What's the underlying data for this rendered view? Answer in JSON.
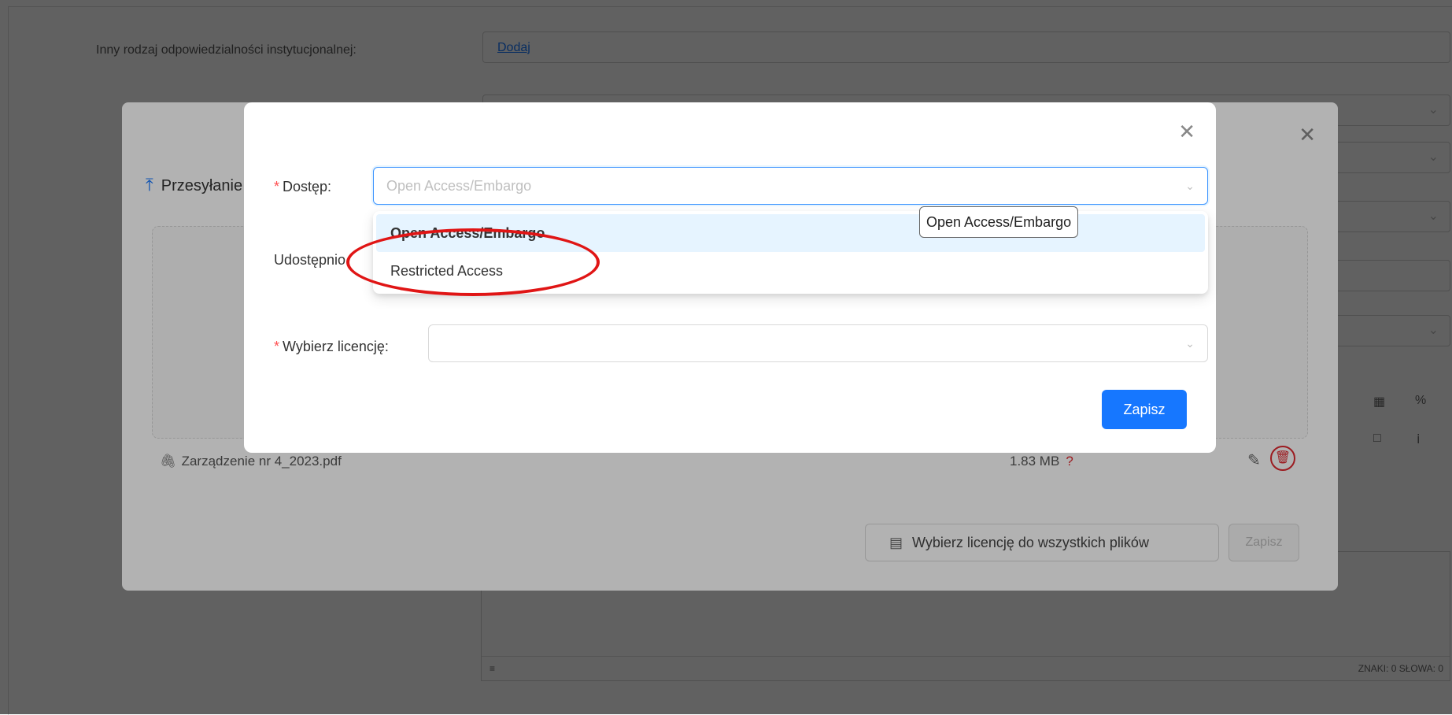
{
  "background": {
    "label_institutional": "Inny rodzaj odpowiedzialności instytucjonalnej:",
    "add_link": "Dodaj",
    "editor_status_left": "≡",
    "editor_status_right": "ZNAKI: 0   SŁOWA: 0"
  },
  "upload_modal": {
    "title": "Przesyłanie",
    "file_name": "Zarządzenie nr 4_2023.pdf",
    "file_size": "1.83 MB",
    "size_hint_icon": "?",
    "select_license_all_label": "Wybierz licencję do wszystkich plików",
    "save_label": "Zapisz",
    "icons": {
      "upload": "upload-icon",
      "close": "close-icon",
      "attachment": "paperclip-icon",
      "edit": "pencil-icon",
      "delete": "trash-icon",
      "license": "list-icon"
    }
  },
  "access_modal": {
    "access_label": "Dostęp:",
    "access_placeholder": "Open Access/Embargo",
    "shared_label": "Udostępnio",
    "license_label": "Wybierz licencję:",
    "save_label": "Zapisz",
    "dropdown_options": [
      "Open Access/Embargo",
      "Restricted Access"
    ],
    "tooltip": "Open Access/Embargo",
    "chevron": "⌄"
  },
  "colors": {
    "primary": "#1677ff",
    "required": "#ff4d4f",
    "highlight": "#e01515",
    "option_active_bg": "#e6f4ff"
  }
}
